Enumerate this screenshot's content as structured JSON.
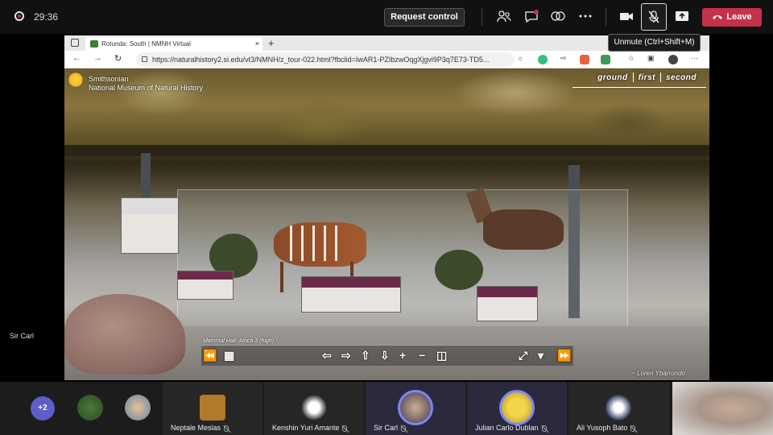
{
  "meeting": {
    "timer": "29:36",
    "request_control_label": "Request control",
    "leave_label": "Leave",
    "mute_tooltip": "Unmute (Ctrl+Shift+M)",
    "icons": [
      "participants-icon",
      "chat-icon",
      "reactions-icon",
      "more-icon",
      "camera-icon",
      "mic-off-icon",
      "share-icon",
      "phone-hangup-icon"
    ],
    "colors": {
      "leave": "#c4314b",
      "accent": "#5b5fc7"
    }
  },
  "browser": {
    "tab_title": "Rotunda: South | NMNH Virtual",
    "url": "https://naturalhistory2.si.edu/vt3/NMNH/z_tour-022.html?fbclid=IwAR1-PZIbzwOqgXjgvi9P3q7E73-TD5...",
    "new_tab_symbol": "+",
    "close_symbol": "×"
  },
  "tour": {
    "logo_line1": "Smithsonian",
    "logo_line2": "National Museum of Natural History",
    "floors": [
      "ground",
      "first",
      "second"
    ],
    "active_floor": "first",
    "hall_label": "Mammal Hall: Africa 3 (high)",
    "credit": "~ Loren Ybarrondo"
  },
  "presenter": {
    "name": "Sir Carl"
  },
  "participants": {
    "overflow_count": "+2",
    "tiles": [
      {
        "name": "Neptale Mesias",
        "muted": true
      },
      {
        "name": "Kenshin Yuri Amante",
        "muted": true
      },
      {
        "name": "Sir Carl",
        "muted": true,
        "highlight": true
      },
      {
        "name": "Julian Carlo Dublan",
        "muted": true,
        "highlight": true
      },
      {
        "name": "Ali Yusoph Bato",
        "muted": true
      }
    ]
  }
}
